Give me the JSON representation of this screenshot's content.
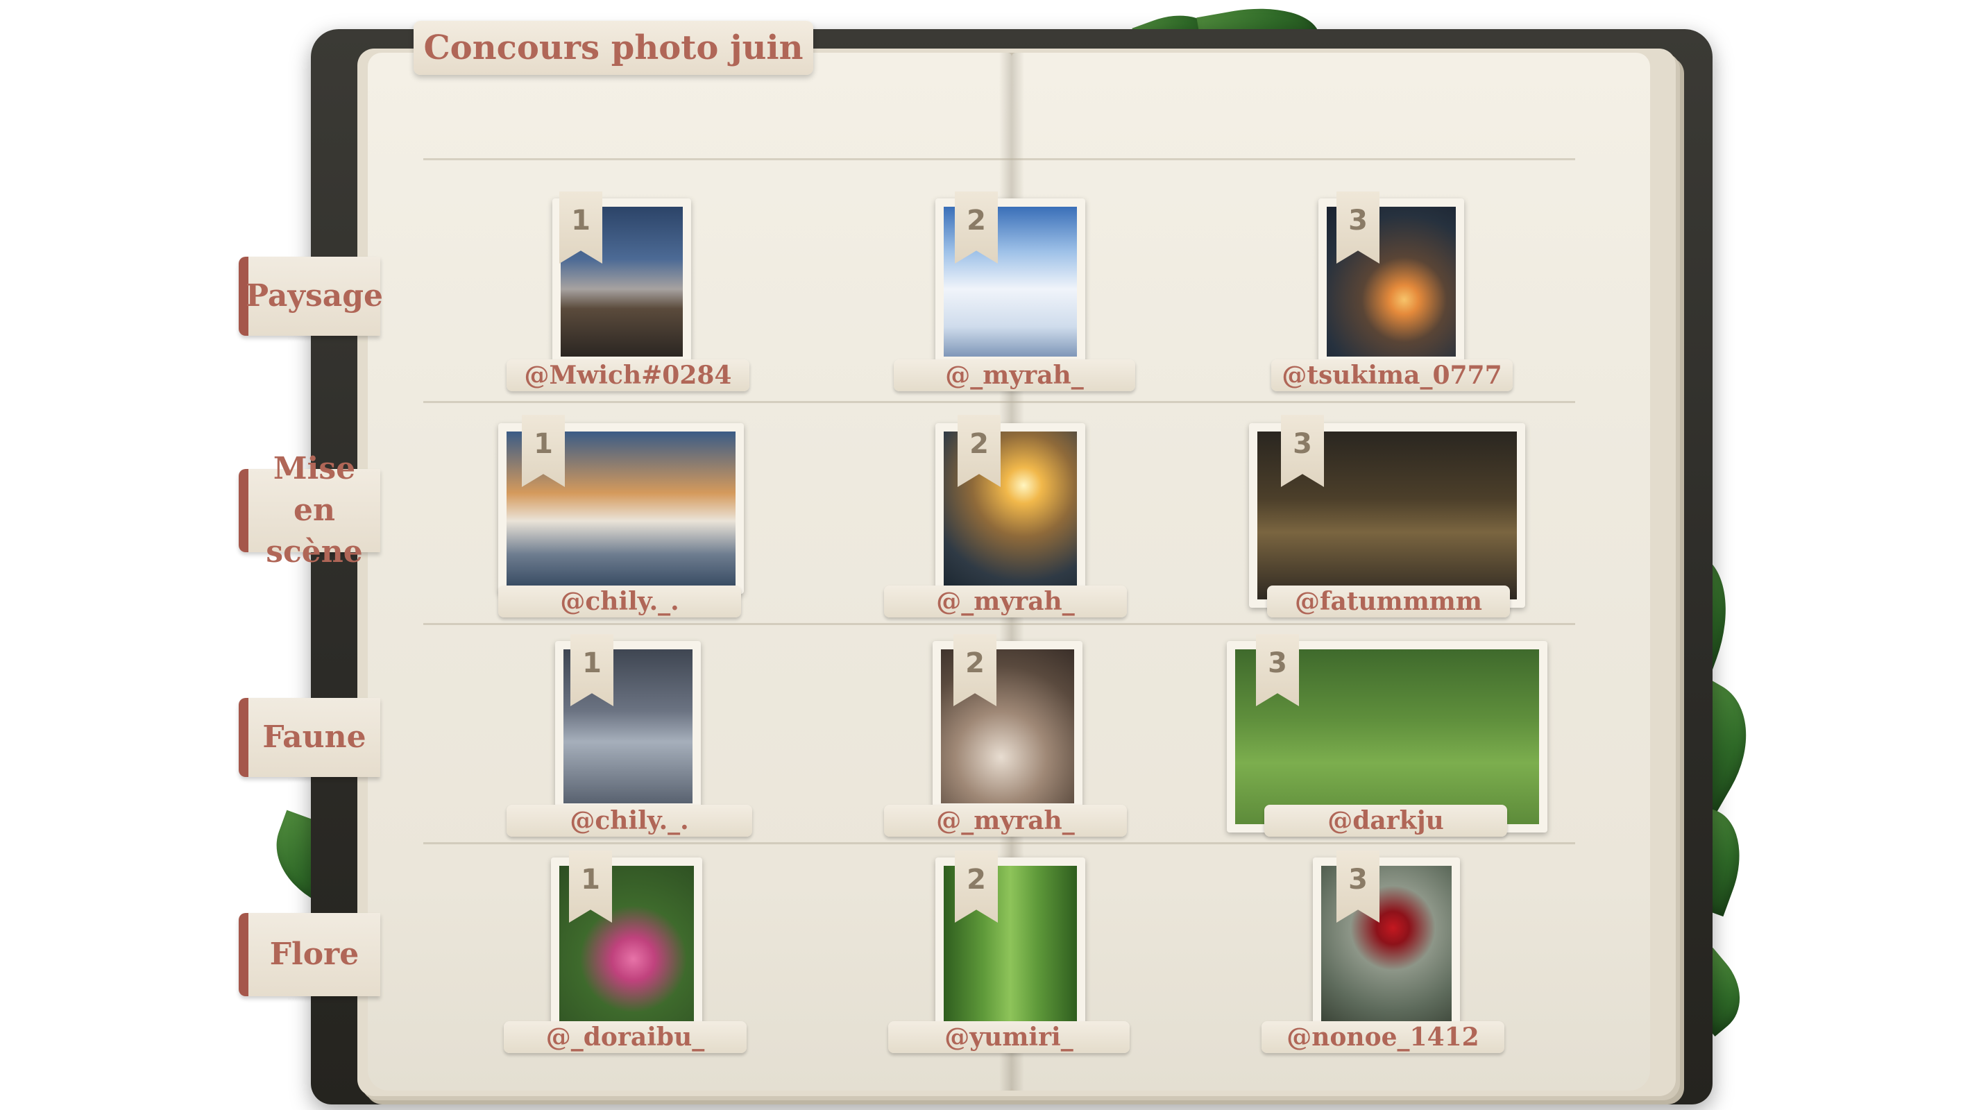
{
  "title": "Concours photo juin",
  "colors": {
    "accent": "#b06657",
    "cover": "#2c2b27",
    "page": "#f0ece2",
    "tab_edge": "#a5574b"
  },
  "categories": [
    {
      "label": "Paysage",
      "entries": [
        {
          "rank": "1",
          "user": "@Mwich#0284"
        },
        {
          "rank": "2",
          "user": "@_myrah_"
        },
        {
          "rank": "3",
          "user": "@tsukima_0777"
        }
      ]
    },
    {
      "label": "Mise en\nscène",
      "entries": [
        {
          "rank": "1",
          "user": "@chily._."
        },
        {
          "rank": "2",
          "user": "@_myrah_"
        },
        {
          "rank": "3",
          "user": "@fatummmm"
        }
      ]
    },
    {
      "label": "Faune",
      "entries": [
        {
          "rank": "1",
          "user": "@chily._."
        },
        {
          "rank": "2",
          "user": "@_myrah_"
        },
        {
          "rank": "3",
          "user": "@darkju"
        }
      ]
    },
    {
      "label": "Flore",
      "entries": [
        {
          "rank": "1",
          "user": "@_doraibu_"
        },
        {
          "rank": "2",
          "user": "@yumiri_"
        },
        {
          "rank": "3",
          "user": "@nonoe_1412"
        }
      ]
    }
  ]
}
